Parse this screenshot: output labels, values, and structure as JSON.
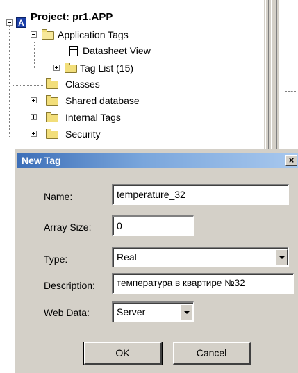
{
  "tree": {
    "root_icon_letter": "A",
    "root_label": "Project: pr1.APP",
    "items": [
      {
        "label": "Application Tags",
        "icon": "open-folder-icon"
      },
      {
        "label": "Datasheet View",
        "icon": "datasheet-icon"
      },
      {
        "label": "Tag List (15)",
        "icon": "folder-icon"
      },
      {
        "label": "Classes",
        "icon": "folder-icon"
      },
      {
        "label": "Shared database",
        "icon": "folder-icon"
      },
      {
        "label": "Internal Tags",
        "icon": "folder-icon"
      },
      {
        "label": "Security",
        "icon": "folder-icon"
      }
    ]
  },
  "dialog": {
    "title": "New Tag",
    "close_glyph": "×",
    "name_label": "Name:",
    "name_value": "temperature_32",
    "array_size_label": "Array Size:",
    "array_size_value": "0",
    "type_label": "Type:",
    "type_value": "Real",
    "description_label": "Description:",
    "description_value": "температура в квартире №32",
    "webdata_label": "Web Data:",
    "webdata_value": "Server",
    "ok_label": "OK",
    "cancel_label": "Cancel"
  },
  "colors": {
    "titlebar_start": "#3d6fb8",
    "titlebar_end": "#a8c8ee",
    "dialog_bg": "#d4d0c8",
    "folder": "#f2de7a"
  }
}
